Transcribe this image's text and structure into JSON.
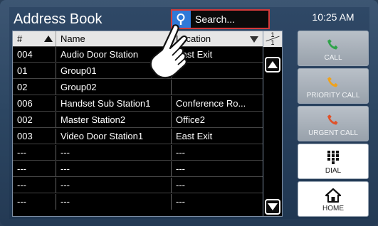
{
  "header": {
    "title": "Address Book",
    "search_placeholder": "Search...",
    "time": "10:25 AM"
  },
  "table": {
    "columns": [
      "#",
      "Name",
      "Location"
    ],
    "rows": [
      [
        "004",
        "Audio Door Station",
        "East Exit"
      ],
      [
        "01",
        "Group01",
        ""
      ],
      [
        "02",
        "Group02",
        ""
      ],
      [
        "006",
        "Handset Sub Station1",
        "Conference Ro..."
      ],
      [
        "002",
        "Master Station2",
        "Office2"
      ],
      [
        "003",
        "Video Door Station1",
        "East Exit"
      ],
      [
        "---",
        "---",
        "---"
      ],
      [
        "---",
        "---",
        "---"
      ],
      [
        "---",
        "---",
        "---"
      ],
      [
        "---",
        "---",
        "---"
      ]
    ]
  },
  "pager": {
    "current": "1",
    "total": "1"
  },
  "side_buttons": {
    "call": "CALL",
    "priority": "PRIORITY CALL",
    "urgent": "URGENT CALL",
    "dial": "DIAL",
    "home": "HOME"
  },
  "colors": {
    "call_icon": "#2fa34a",
    "priority_icon": "#f0a21b",
    "urgent_icon": "#e0522a",
    "search_border": "#d43a3a",
    "search_icon_bg": "#2f79d8"
  },
  "icons": {
    "search": "magnifier-icon",
    "call": "phone-icon",
    "dial": "keypad-icon",
    "home": "home-icon",
    "cursor": "pointing-hand-icon"
  }
}
